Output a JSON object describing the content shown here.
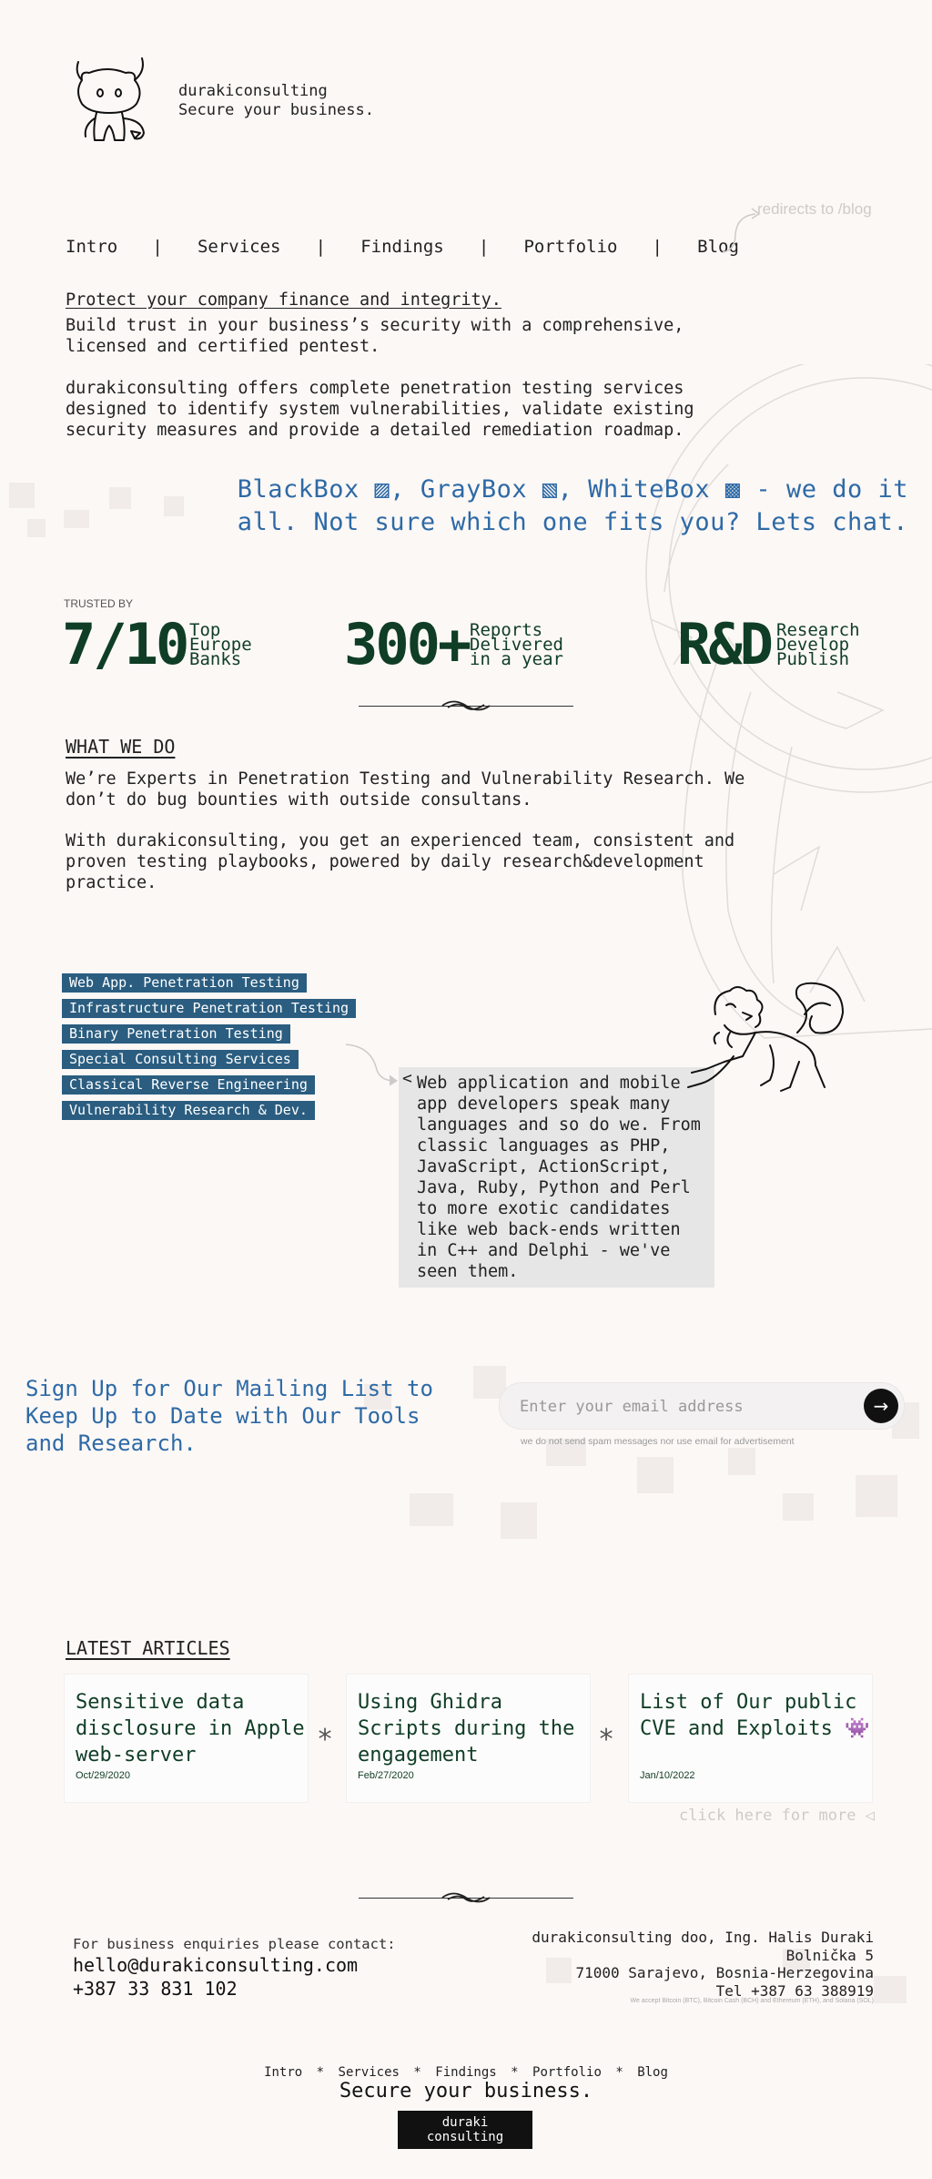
{
  "brand": {
    "name": "durakiconsulting",
    "tagline": "Secure your business."
  },
  "nav": {
    "items": [
      "Intro",
      "Services",
      "Findings",
      "Portfolio",
      "Blog"
    ],
    "separator": "|",
    "blog_note": "redirects to /blog"
  },
  "intro": {
    "heading": "Protect your company finance and integrity.",
    "lead": "Build trust in your business’s security with a comprehensive, licensed and certified pentest.",
    "body": "durakiconsulting offers complete penetration testing services designed to identify system vulnerabilities, validate existing security measures and provide a detailed remediation roadmap."
  },
  "headline": {
    "line1": "BlackBox ▨, GrayBox ▧, WhiteBox ▩ - we do it",
    "line2": "all. Not sure which one fits you? Lets chat."
  },
  "trusted": {
    "label": "TRUSTED BY",
    "stats": [
      {
        "value": "7/10",
        "label": [
          "Top",
          "Europe",
          "Banks"
        ]
      },
      {
        "value": "300+",
        "label": [
          "Reports",
          "Delivered",
          "in a year"
        ]
      },
      {
        "value": "R&D",
        "label": [
          "Research",
          "Develop",
          "Publish"
        ]
      }
    ]
  },
  "what_we_do": {
    "title": "WHAT WE DO",
    "p1": "We’re Experts in Penetration Testing and Vulnerability Research. We don’t do bug bounties with outside consultans.",
    "p2": "With durakiconsulting, you get an experienced team, consistent and proven testing playbooks, powered by daily research&development practice."
  },
  "services": {
    "tags": [
      "Web App. Penetration Testing",
      "Infrastructure Penetration Testing",
      "Binary Penetration Testing",
      "Special Consulting Services",
      "Classical Reverse Engineering",
      "Vulnerability Research & Dev."
    ],
    "bubble_arrow": "<",
    "bubble_text": "Web application and mobile app developers speak many languages and so do we. From classic languages as PHP, JavaScript, ActionScript, Java, Ruby, Python and Perl to more exotic candidates like web back-ends written in C++ and Delphi - we've seen them."
  },
  "signup": {
    "title": "Sign Up for Our Mailing List to Keep Up to Date with Our Tools and Research.",
    "placeholder": "Enter your email address",
    "button": "→",
    "note": "we do not send spam messages nor use email for advertisement"
  },
  "articles": {
    "title": "LATEST ARTICLES",
    "separator": "*",
    "items": [
      {
        "title": "Sensitive data disclosure in Apple web-server",
        "date": "Oct/29/2020"
      },
      {
        "title": "Using Ghidra Scripts during the engagement",
        "date": "Feb/27/2020"
      },
      {
        "title": "List of Our public CVE and Exploits 👾",
        "date": "Jan/10/2022"
      }
    ],
    "more": "click here for more ◁"
  },
  "contact": {
    "label": "For business enquiries please contact:",
    "email": "hello@durakiconsulting.com",
    "phone": "+387 33 831 102",
    "address": [
      "durakiconsulting doo, Ing. Halis Duraki",
      "Bolnička 5",
      "71000 Sarajevo, Bosnia-Herzegovina",
      "Tel +387 63 388919"
    ],
    "crypto": "We accept Bitcoin (BTC), Bitcoin Cash (BCH) and Ethereum (ETH), and Solana (SOL)"
  },
  "footer": {
    "nav": [
      "Intro",
      "Services",
      "Findings",
      "Portfolio",
      "Blog"
    ],
    "separator": "*",
    "tagline": "Secure your business.",
    "button": [
      "duraki",
      "consulting"
    ]
  },
  "colors": {
    "background": "#fcf8f6",
    "headline_blue": "#2e6aa6",
    "stat_green": "#0f3d25",
    "tag_blue": "#2a5d80",
    "bubble_gray": "#e6e6e6"
  }
}
